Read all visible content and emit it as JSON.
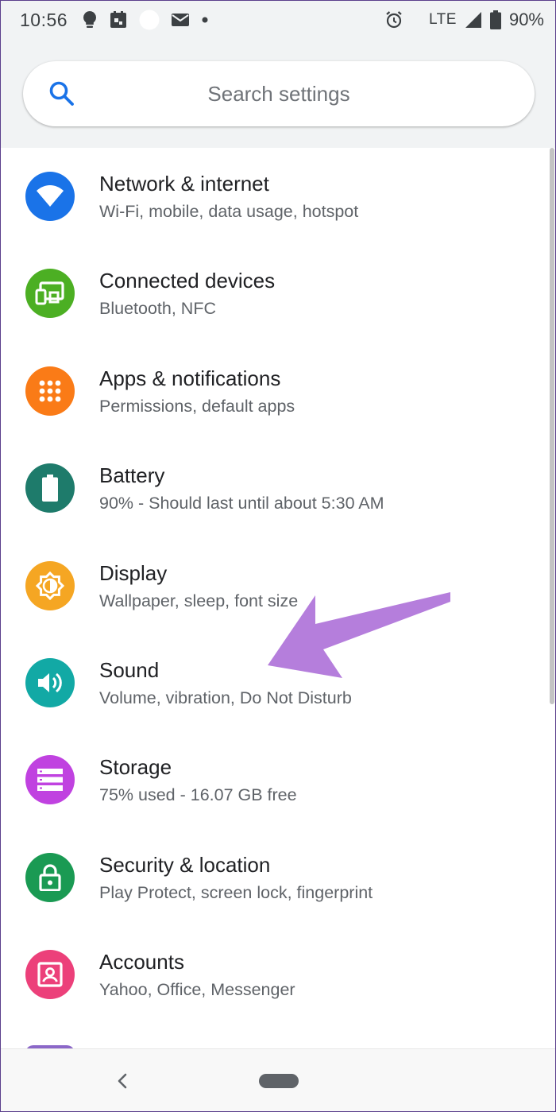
{
  "status_bar": {
    "time": "10:56",
    "network": "LTE",
    "battery_percent": "90%",
    "left_icons": [
      "bulb-icon",
      "calendar-icon",
      "circle-icon",
      "mail-icon",
      "dot-icon"
    ],
    "right_icons": [
      "alarm-icon",
      "signal-icon",
      "battery-icon"
    ]
  },
  "search": {
    "placeholder": "Search settings"
  },
  "settings": [
    {
      "title": "Network & internet",
      "summary": "Wi-Fi, mobile, data usage, hotspot",
      "icon": "wifi-icon",
      "color": "#1a73e8"
    },
    {
      "title": "Connected devices",
      "summary": "Bluetooth, NFC",
      "icon": "devices-icon",
      "color": "#4caf23"
    },
    {
      "title": "Apps & notifications",
      "summary": "Permissions, default apps",
      "icon": "apps-grid-icon",
      "color": "#fa7b17"
    },
    {
      "title": "Battery",
      "summary": "90% - Should last until about 5:30 AM",
      "icon": "battery-icon",
      "color": "#1e7b6b"
    },
    {
      "title": "Display",
      "summary": "Wallpaper, sleep, font size",
      "icon": "brightness-icon",
      "color": "#f5a623"
    },
    {
      "title": "Sound",
      "summary": "Volume, vibration, Do Not Disturb",
      "icon": "volume-icon",
      "color": "#12a9a5"
    },
    {
      "title": "Storage",
      "summary": "75% used - 16.07 GB free",
      "icon": "storage-icon",
      "color": "#c042e0"
    },
    {
      "title": "Security & location",
      "summary": "Play Protect, screen lock, fingerprint",
      "icon": "lock-icon",
      "color": "#1a9a53"
    },
    {
      "title": "Accounts",
      "summary": "Yahoo, Office, Messenger",
      "icon": "account-box-icon",
      "color": "#ec407a"
    }
  ],
  "annotation": {
    "color": "#b57edc",
    "icon": "arrow-annotation"
  },
  "nav_bar": {
    "icons": [
      "back-icon",
      "home-pill-icon"
    ]
  }
}
